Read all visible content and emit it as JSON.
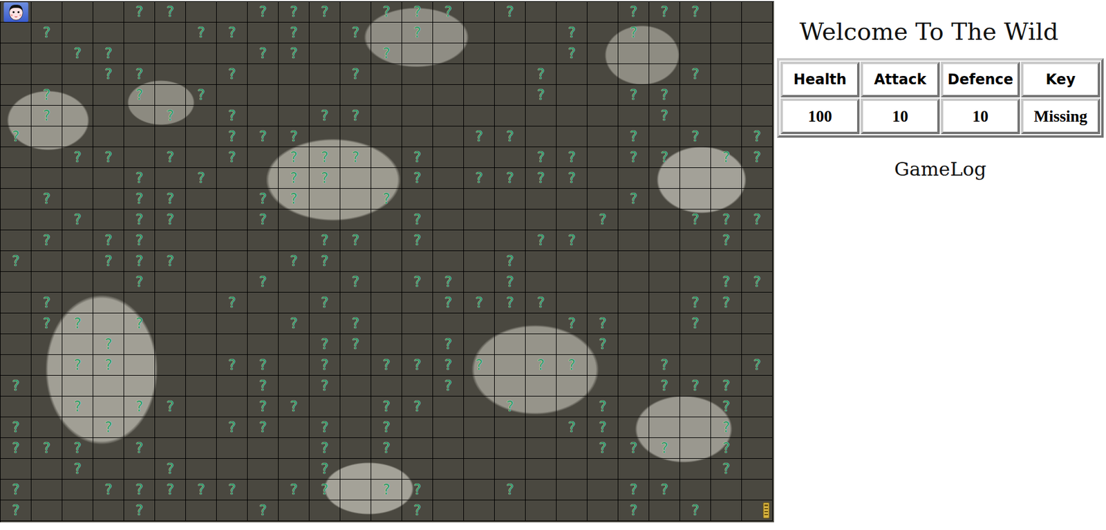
{
  "title": "Welcome To The Wild",
  "stats": [
    {
      "label": "Health",
      "value": "100"
    },
    {
      "label": "Attack",
      "value": "10"
    },
    {
      "label": "Defence",
      "value": "10"
    },
    {
      "label": "Key",
      "value": "Missing"
    }
  ],
  "log": {
    "title": "GameLog"
  },
  "board": {
    "size": 25,
    "mark": "?",
    "player": {
      "row": 0,
      "col": 0
    },
    "key": {
      "row": 24,
      "col": 24
    },
    "marks": [
      [
        4,
        5,
        8,
        9,
        10,
        12,
        13,
        14,
        16,
        20,
        21,
        22
      ],
      [
        1,
        6,
        7,
        9,
        11,
        13,
        18,
        20
      ],
      [
        2,
        3,
        8,
        9,
        12,
        18
      ],
      [
        3,
        4,
        7,
        11,
        17,
        22
      ],
      [
        1,
        4,
        6,
        17,
        20,
        21
      ],
      [
        1,
        5,
        7,
        10,
        11,
        21
      ],
      [
        0,
        7,
        8,
        9,
        15,
        16,
        20,
        22,
        24
      ],
      [
        2,
        3,
        5,
        7,
        9,
        10,
        11,
        13,
        17,
        18,
        20,
        21,
        23,
        24
      ],
      [
        4,
        6,
        9,
        10,
        13,
        15,
        16,
        17,
        18
      ],
      [
        1,
        4,
        5,
        8,
        9,
        12,
        20
      ],
      [
        2,
        4,
        5,
        8,
        13,
        19,
        22,
        23,
        24
      ],
      [
        1,
        3,
        4,
        10,
        11,
        13,
        17,
        18,
        23
      ],
      [
        0,
        3,
        4,
        5,
        9,
        10,
        16
      ],
      [
        4,
        8,
        11,
        13,
        14,
        16,
        23,
        24
      ],
      [
        1,
        7,
        10,
        14,
        15,
        16,
        17,
        22,
        23
      ],
      [
        1,
        2,
        4,
        9,
        11,
        18,
        19,
        22
      ],
      [
        3,
        10,
        11,
        14,
        19
      ],
      [
        2,
        3,
        7,
        8,
        10,
        12,
        13,
        14,
        15,
        17,
        18,
        21,
        24
      ],
      [
        0,
        8,
        10,
        14,
        21,
        22,
        23
      ],
      [
        2,
        4,
        5,
        8,
        9,
        12,
        13,
        16,
        19,
        23
      ],
      [
        0,
        3,
        7,
        8,
        10,
        12,
        18,
        19,
        23
      ],
      [
        0,
        1,
        2,
        4,
        10,
        12,
        19,
        20,
        21,
        23
      ],
      [
        2,
        5,
        10,
        23
      ],
      [
        0,
        3,
        4,
        5,
        6,
        7,
        9,
        10,
        12,
        13,
        16,
        20,
        21
      ],
      [
        0,
        4,
        8,
        13,
        20,
        22
      ]
    ]
  }
}
